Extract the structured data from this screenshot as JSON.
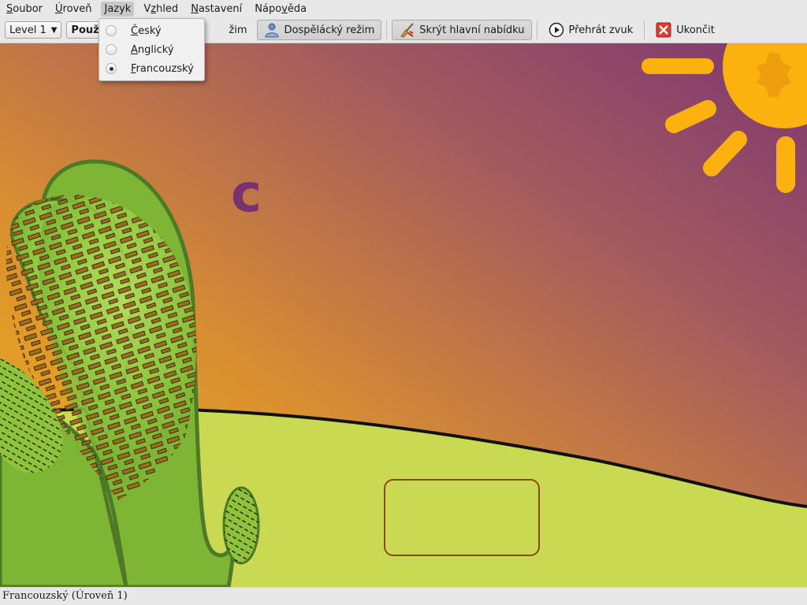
{
  "menubar": {
    "items": [
      {
        "pre": "",
        "key": "S",
        "post": "oubor"
      },
      {
        "pre": "",
        "key": "Ú",
        "post": "roveň"
      },
      {
        "pre": "",
        "key": "J",
        "post": "azyk"
      },
      {
        "pre": "V",
        "key": "z",
        "post": "hled"
      },
      {
        "pre": "",
        "key": "N",
        "post": "astavení"
      },
      {
        "pre": "Nápo",
        "key": "v",
        "post": "ěda"
      }
    ],
    "active_index": 2
  },
  "toolbar": {
    "level_value": "Level 1",
    "mode_value": "Používat",
    "kids_mode_fragment": "žim",
    "adult_mode_label": "Dospělácký režim",
    "hide_menu_label": "Skrýt hlavní nabídku",
    "play_sound_label": "Přehrát zvuk",
    "quit_label": "Ukončit"
  },
  "language_menu": {
    "items": [
      {
        "key": "Č",
        "rest": "eský",
        "checked": false
      },
      {
        "key": "A",
        "rest": "nglický",
        "checked": false
      },
      {
        "key": "F",
        "rest": "rancouzský",
        "checked": true
      }
    ]
  },
  "game": {
    "letter": "c",
    "answer": ""
  },
  "status": {
    "text": "Francouzský (Úroveň 1)"
  },
  "icons": {
    "adult_mode": "adult-user-icon",
    "hide_menu": "broom-icon",
    "play_sound": "play-icon",
    "quit": "quit-icon"
  }
}
